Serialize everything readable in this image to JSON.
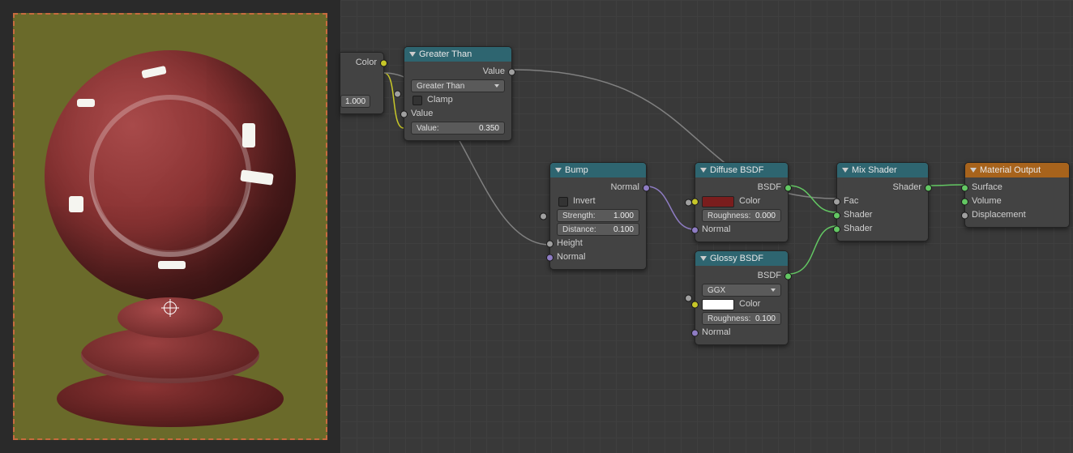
{
  "preview": {
    "alt": "Material preview sphere"
  },
  "nodes": {
    "partial": {
      "out_color": "Color",
      "value": "1.000"
    },
    "greater": {
      "title": "Greater Than",
      "out_value": "Value",
      "dropdown": "Greater Than",
      "clamp": "Clamp",
      "in_value_label": "Value",
      "in_value": "Value:",
      "in_value_num": "0.350"
    },
    "bump": {
      "title": "Bump",
      "out_normal": "Normal",
      "invert": "Invert",
      "strength_l": "Strength:",
      "strength_v": "1.000",
      "distance_l": "Distance:",
      "distance_v": "0.100",
      "height": "Height",
      "normal": "Normal"
    },
    "diffuse": {
      "title": "Diffuse BSDF",
      "out": "BSDF",
      "color": "Color",
      "color_hex": "#7a1d1d",
      "rough_l": "Roughness:",
      "rough_v": "0.000",
      "normal": "Normal"
    },
    "glossy": {
      "title": "Glossy BSDF",
      "out": "BSDF",
      "dist": "GGX",
      "color": "Color",
      "color_hex": "#ffffff",
      "rough_l": "Roughness:",
      "rough_v": "0.100",
      "normal": "Normal"
    },
    "mix": {
      "title": "Mix Shader",
      "out": "Shader",
      "fac": "Fac",
      "shader1": "Shader",
      "shader2": "Shader"
    },
    "output": {
      "title": "Material Output",
      "surface": "Surface",
      "volume": "Volume",
      "displacement": "Displacement"
    }
  }
}
